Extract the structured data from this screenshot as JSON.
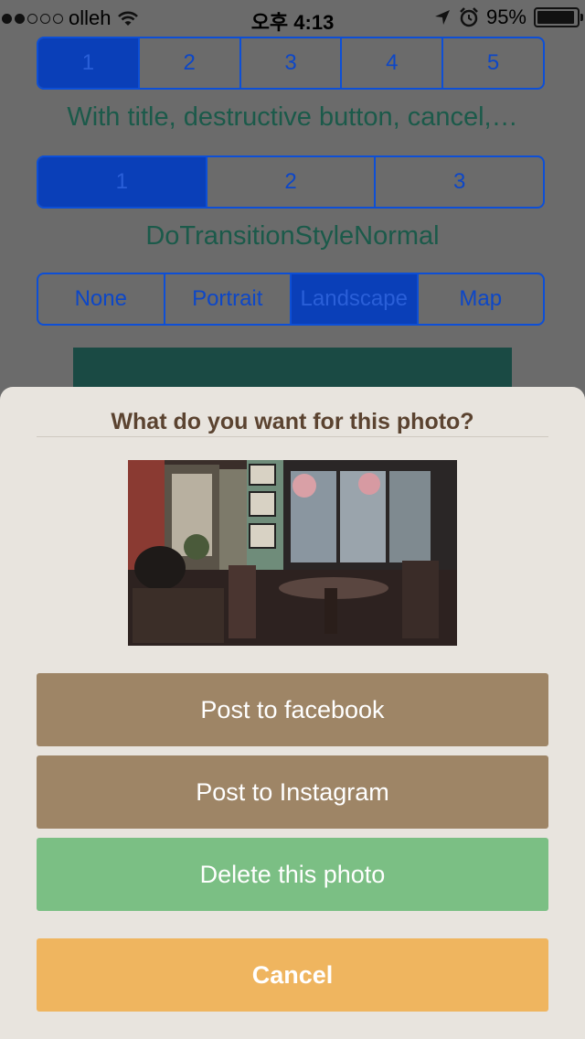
{
  "status_bar": {
    "carrier": "olleh",
    "time": "오후 4:13",
    "battery": "95%",
    "battery_level": 0.95,
    "signal_icon": "signal-dots-icon",
    "wifi_icon": "wifi-icon",
    "location_icon": "location-arrow-icon",
    "alarm_icon": "alarm-icon"
  },
  "segment_top": {
    "items": [
      "1",
      "2",
      "3",
      "4",
      "5"
    ],
    "selected": "1"
  },
  "caption1": "With title, destructive button, cancel,…",
  "segment_mid": {
    "items": [
      "1",
      "2",
      "3"
    ],
    "selected": "1"
  },
  "caption2": "DoTransitionStyleNormal",
  "segment_style": {
    "items": [
      "None",
      "Portrait",
      "Landscape",
      "Map"
    ],
    "selected": "Landscape"
  },
  "action_sheet": {
    "title": "What do you want for this photo?",
    "buttons": {
      "facebook": "Post to facebook",
      "instagram": "Post to Instagram",
      "delete": "Delete this photo",
      "cancel": "Cancel"
    }
  },
  "colors": {
    "accent_blue": "#0d4fd6",
    "sheet_bg": "#e8e4de",
    "brown_button": "#9e8566",
    "green_button": "#7bbf84",
    "cancel_button": "#efb55f",
    "title_color": "#5b4330"
  }
}
